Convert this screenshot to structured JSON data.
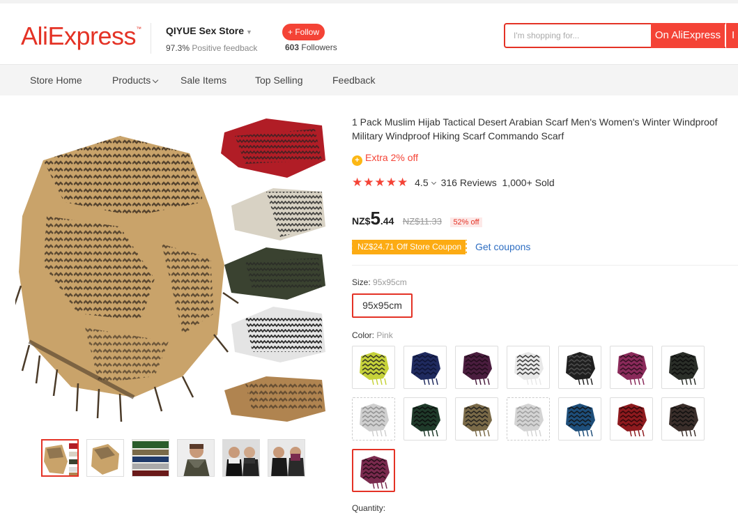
{
  "header": {
    "logo": "AliExpress",
    "store_name": "QIYUE Sex Store",
    "feedback_pct": "97.3%",
    "feedback_label": "Positive feedback",
    "follow_label": "+ Follow",
    "followers_count": "603",
    "followers_label": "Followers",
    "search_placeholder": "I'm shopping for...",
    "search_button": "On AliExpress",
    "search_button2": "I"
  },
  "nav": {
    "items": [
      "Store Home",
      "Products",
      "Sale Items",
      "Top Selling",
      "Feedback"
    ]
  },
  "product": {
    "title": "1 Pack Muslim Hijab Tactical Desert Arabian Scarf Men's Women's Winter Windproof Military Windproof Hiking Scarf Commando Scarf",
    "extra_off": "Extra 2% off",
    "rating": "4.5",
    "stars": 5,
    "reviews": "316 Reviews",
    "sold": "1,000+ Sold",
    "currency": "NZ$",
    "price_int": "5",
    "price_dec": ".44",
    "original_price": "NZ$11.33",
    "discount": "52% off",
    "coupon": "NZ$24.71 Off Store Coupon",
    "get_coupons": "Get coupons",
    "size_label": "Size:",
    "size_selected": "95x95cm",
    "size_option": "95x95cm",
    "color_label": "Color:",
    "color_selected": "Pink",
    "quantity_label": "Quantity:"
  },
  "colors": {
    "tan": "#c9a36a",
    "pattern": "#5a4a36",
    "brand_red": "#e43225",
    "coupon_orange": "#fcab13",
    "link_blue": "#2e6ec2"
  },
  "swatches": [
    {
      "name": "yellow-green",
      "base": "#c6d23a",
      "dark": "#222"
    },
    {
      "name": "navy",
      "base": "#1f2a5e",
      "dark": "#0d1230"
    },
    {
      "name": "purple",
      "base": "#4a1d3e",
      "dark": "#1e0b19"
    },
    {
      "name": "grey-white",
      "base": "#e8e8e8",
      "dark": "#222"
    },
    {
      "name": "black",
      "base": "#1f1f1f",
      "dark": "#555"
    },
    {
      "name": "magenta",
      "base": "#8a2a5a",
      "dark": "#2a0d1c"
    },
    {
      "name": "black-olive",
      "base": "#2a2e28",
      "dark": "#0a0a0a"
    },
    {
      "name": "light-grey",
      "base": "#cfcfcf",
      "dark": "#8a8a8a"
    },
    {
      "name": "dark-green",
      "base": "#1f3a2a",
      "dark": "#0a0a0a"
    },
    {
      "name": "khaki-black",
      "base": "#7a6a48",
      "dark": "#1a1a1a"
    },
    {
      "name": "silver",
      "base": "#d4d4d4",
      "dark": "#999"
    },
    {
      "name": "blue",
      "base": "#1e4e7a",
      "dark": "#111"
    },
    {
      "name": "red",
      "base": "#8e1a1e",
      "dark": "#2a0608"
    },
    {
      "name": "dark-brown",
      "base": "#3a2e2a",
      "dark": "#0c0c0c"
    },
    {
      "name": "pink",
      "base": "#7a2a4e",
      "dark": "#1e0a14"
    }
  ]
}
